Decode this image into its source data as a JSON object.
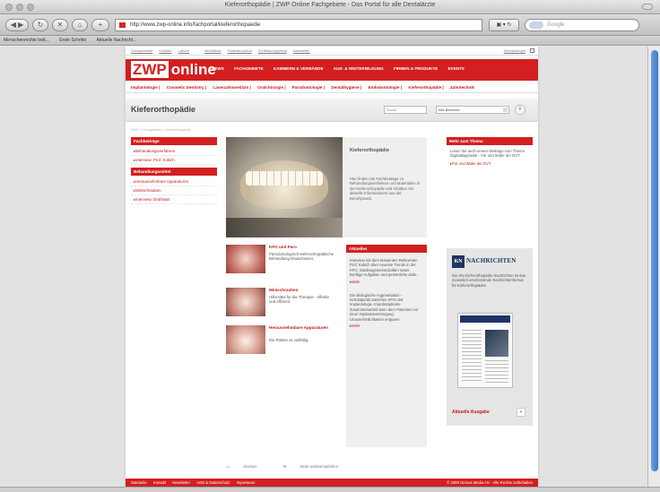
{
  "window": {
    "title": "Kieferorthopädie | ZWP Online Fachgebiete - Das Portal für alle Dentalärzte"
  },
  "toolbar": {
    "back_icon": "back-arrow-icon",
    "url": "http://www.zwp-online.info/fachportal/kieferorthopaedie",
    "search_placeholder": "Google"
  },
  "bookmarks": [
    "Menschenrechte bett...",
    "Erste Schritte",
    "Aktuelle Nachricht..."
  ],
  "site": {
    "top_links": [
      "Zahnarztseite",
      "Kliniken",
      "Labore",
      "Mediathek",
      "Patientenportal",
      "Fortbildungsportal",
      "Newsletter"
    ],
    "top_right": "Zahnarztlogin",
    "logo_zwp": "ZWP",
    "logo_online": "online",
    "main_nav": [
      "NEWS",
      "FACHGEBIETE",
      "KAMMERN & VERBÄNDE",
      "AUS- & WEITERBILDUNG",
      "FIRMEN & PRODUKTE",
      "EVENTS"
    ],
    "sub_nav": [
      "Implantologie",
      "Cosmetic Dentistry",
      "Laserzahnmedizin",
      "Oralchirurgie",
      "Parodontologie",
      "Dentalhygiene",
      "Endodontologie",
      "Kieferorthopädie",
      "Zahntechnik"
    ],
    "page_title": "Kieferorthopädie",
    "search_label": "Suche",
    "select_value": "Alle Bereiche",
    "breadcrumb": "ZWP  |  Fachgebiete  |  Kieferorthopädie"
  },
  "left_nav": {
    "section1_title": "Fachbeiträge",
    "section1_items": [
      "Behandlungsverfahren",
      "Interview: Prof. Kokich"
    ],
    "section2_title": "Behandlungsmittel",
    "section2_items": [
      "Herausnehmbare Apparaturen",
      "Minischrauben",
      "Interview: Drahtsatt"
    ]
  },
  "hero": {
    "title": "Kieferorthopädie",
    "text": "Hier finden Sie Fachbeiträge zu Behandlungsverfahren und Materialien in der Kieferorthopädie und erhalten Sie aktuelle Informationen aus der Berufspraxis."
  },
  "teasers": [
    {
      "title": "KFO und Paro",
      "text": "Parodontologisch-kieferorthopädische Behandlung Erwachsener."
    },
    {
      "title": "Minischrauben",
      "text": "Hilfsmittel für die Therapie - effektiv und effizient."
    },
    {
      "title": "Herausnehmbare Apparaturen",
      "text": "Die Palette ist vielfältig."
    }
  ],
  "aktuelles": {
    "title": "Aktuelles",
    "p1": "Interview mit dem bekannten Referenten Prof. Kokich über neueste Trends in der KFO, Studiengemeinschaften sowie künftige Aufgaben und persönliche Ziele.",
    "more1": "Mehr",
    "p2": "Die Biologische Augmentation - Schnittpunkt zwischen KFO und Implantologie. Interdisziplinäre Zusammenarbeit kann dem Patienten vor einer Implantatversorgung Unannehmlichkeiten ersparen.",
    "more2": "Mehr"
  },
  "right": {
    "title": "Mehr zum Thema",
    "text": "Lesen Sie auch unsere Beiträge zum Thema Digitaldiagnostik - Für und Wider der DVT",
    "link": "Für und Wider der DVT",
    "kn_mark": "KN",
    "kn_name": "NACHRICHTEN",
    "kn_text": "Die KN Kieferorthopädie Nachrichten ist das monatlich erscheinende Nachrichtenformat für Kieferorthopäden.",
    "issue_label": "Aktuelle Ausgabe",
    "issue_btn": "+"
  },
  "actions": {
    "print": "drucken",
    "recommend": "Seite weiterempfehlen"
  },
  "footer": {
    "links": [
      "Startseite",
      "Kontakt",
      "Newsletter",
      "AGB & Datenschutz",
      "Impressum"
    ],
    "copyright": "© 2009 Oemus Media AG - Alle Rechte vorbehalten"
  }
}
